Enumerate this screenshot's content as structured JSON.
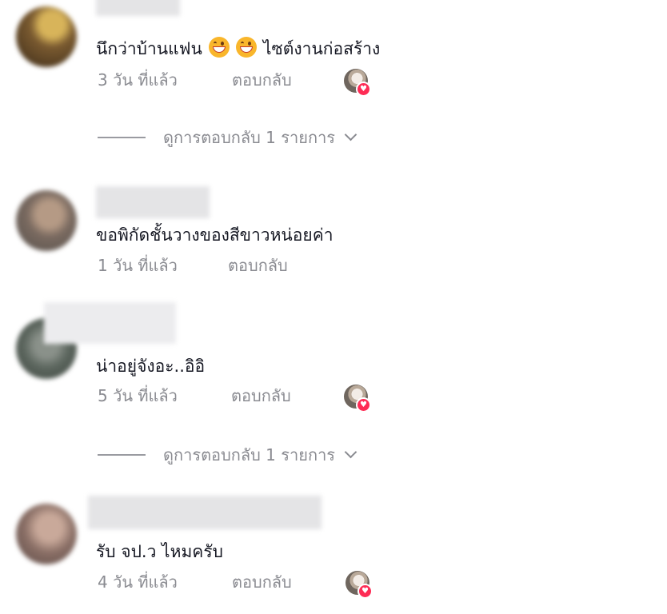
{
  "comments": [
    {
      "text_before_emoji": "นึกว่าบ้านแฟน",
      "text_after_emoji": "ไซต์งานก่อสร้าง",
      "emoji_count": 2,
      "time": "3 วัน ที่แล้ว",
      "reply_label": "ตอบกลับ",
      "liked_by_creator": true,
      "view_replies": "ดูการตอบกลับ 1 รายการ"
    },
    {
      "text": "ขอพิกัดชั้นวางของสีขาวหน่อยค่า",
      "time": "1 วัน ที่แล้ว",
      "reply_label": "ตอบกลับ",
      "liked_by_creator": false
    },
    {
      "text": "น่าอยู่จังอะ..อิอิ",
      "time": "5 วัน ที่แล้ว",
      "reply_label": "ตอบกลับ",
      "liked_by_creator": true,
      "view_replies": "ดูการตอบกลับ 1 รายการ"
    },
    {
      "text": "รับ จป.ว ไหมครับ",
      "time": "4 วัน ที่แล้ว",
      "reply_label": "ตอบกลับ",
      "liked_by_creator": true
    }
  ],
  "colors": {
    "heart": "#fe2c55",
    "secondary_text": "#8a8b91",
    "primary_text": "#161823"
  }
}
